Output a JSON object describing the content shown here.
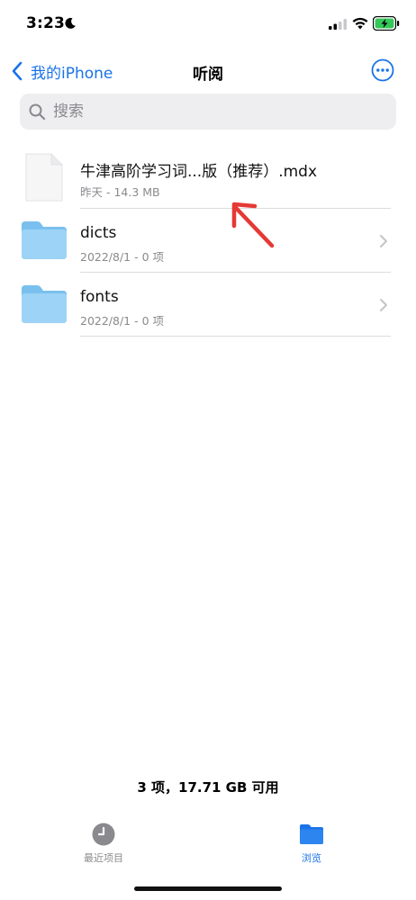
{
  "status_bar": {
    "time": "3:23"
  },
  "nav": {
    "back_label": "我的iPhone",
    "title": "听阅"
  },
  "search": {
    "placeholder": "搜索"
  },
  "files": [
    {
      "name": "牛津高阶学习词...版（推荐）.mdx",
      "meta": "昨天 - 14.3 MB",
      "icon": "document-icon"
    },
    {
      "name": "dicts",
      "meta": "2022/8/1 - 0 项",
      "icon": "folder-icon"
    },
    {
      "name": "fonts",
      "meta": "2022/8/1 - 0 项",
      "icon": "folder-icon"
    }
  ],
  "storage": "3 项，17.71 GB 可用",
  "tabs": [
    {
      "label": "最近项目",
      "icon": "clock-icon",
      "active": false
    },
    {
      "label": "浏览",
      "icon": "folder-icon",
      "active": true
    }
  ],
  "colors": {
    "accent": "#1a73e8",
    "folder": "#8ecdf4",
    "annotation": "#e53935",
    "inactive": "#8a8a8e"
  }
}
